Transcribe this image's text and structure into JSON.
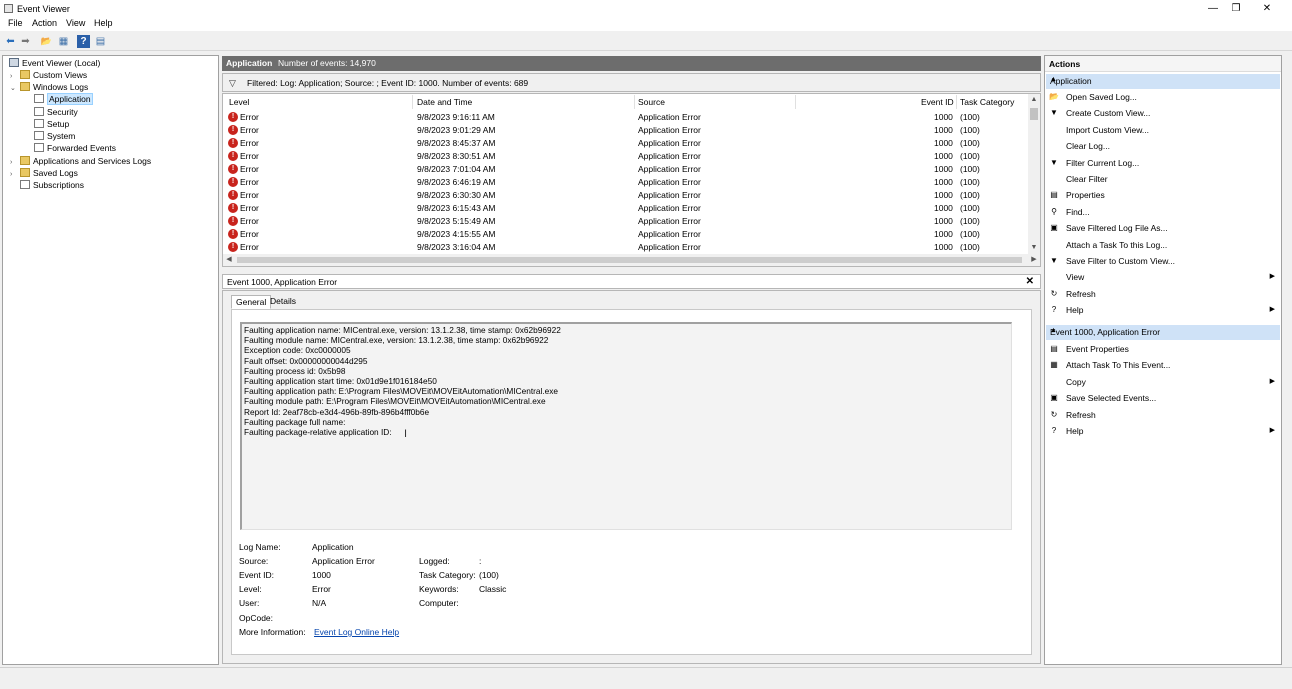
{
  "window": {
    "title": "Event Viewer",
    "minimize": "—",
    "restore": "❐",
    "close": "✕"
  },
  "menu": [
    "File",
    "Action",
    "View",
    "Help"
  ],
  "toolbar": {
    "back": "⬅",
    "forward": "➡",
    "up": "📂",
    "show_hide": "▦",
    "help": "?",
    "console": "▤"
  },
  "tree": {
    "items": [
      {
        "label": "Event Viewer (Local)",
        "expander": ""
      },
      {
        "label": "Custom Views",
        "expander": "›"
      },
      {
        "label": "Windows Logs",
        "expander": "⌄"
      },
      {
        "label": "Application",
        "expander": ""
      },
      {
        "label": "Security",
        "expander": ""
      },
      {
        "label": "Setup",
        "expander": ""
      },
      {
        "label": "System",
        "expander": ""
      },
      {
        "label": "Forwarded Events",
        "expander": ""
      },
      {
        "label": "Applications and Services Logs",
        "expander": "›"
      },
      {
        "label": "Saved Logs",
        "expander": "›"
      },
      {
        "label": "Subscriptions",
        "expander": ""
      }
    ]
  },
  "center": {
    "header_log": "Application",
    "header_count": "Number of events: 14,970",
    "filter_text": "Filtered: Log: Application; Source: ; Event ID: 1000. Number of events: 689"
  },
  "grid": {
    "columns": [
      "Level",
      "Date and Time",
      "Source",
      "Event ID",
      "Task Category"
    ],
    "rows": [
      {
        "level": "Error",
        "date": "9/8/2023 9:16:11 AM",
        "source": "Application Error",
        "event_id": "1000",
        "task": "(100)"
      },
      {
        "level": "Error",
        "date": "9/8/2023 9:01:29 AM",
        "source": "Application Error",
        "event_id": "1000",
        "task": "(100)"
      },
      {
        "level": "Error",
        "date": "9/8/2023 8:45:37 AM",
        "source": "Application Error",
        "event_id": "1000",
        "task": "(100)"
      },
      {
        "level": "Error",
        "date": "9/8/2023 8:30:51 AM",
        "source": "Application Error",
        "event_id": "1000",
        "task": "(100)"
      },
      {
        "level": "Error",
        "date": "9/8/2023 7:01:04 AM",
        "source": "Application Error",
        "event_id": "1000",
        "task": "(100)"
      },
      {
        "level": "Error",
        "date": "9/8/2023 6:46:19 AM",
        "source": "Application Error",
        "event_id": "1000",
        "task": "(100)"
      },
      {
        "level": "Error",
        "date": "9/8/2023 6:30:30 AM",
        "source": "Application Error",
        "event_id": "1000",
        "task": "(100)"
      },
      {
        "level": "Error",
        "date": "9/8/2023 6:15:43 AM",
        "source": "Application Error",
        "event_id": "1000",
        "task": "(100)"
      },
      {
        "level": "Error",
        "date": "9/8/2023 5:15:49 AM",
        "source": "Application Error",
        "event_id": "1000",
        "task": "(100)"
      },
      {
        "level": "Error",
        "date": "9/8/2023 4:15:55 AM",
        "source": "Application Error",
        "event_id": "1000",
        "task": "(100)"
      },
      {
        "level": "Error",
        "date": "9/8/2023 3:16:04 AM",
        "source": "Application Error",
        "event_id": "1000",
        "task": "(100)"
      }
    ]
  },
  "detail": {
    "header": "Event 1000, Application Error",
    "close": "✕",
    "tabs": [
      "General",
      "Details"
    ],
    "description_lines": [
      "Faulting application name: MICentral.exe, version: 13.1.2.38, time stamp: 0x62b96922",
      "Faulting module name: MICentral.exe, version: 13.1.2.38, time stamp: 0x62b96922",
      "Exception code: 0xc0000005",
      "Fault offset: 0x00000000044d295",
      "Faulting process id: 0x5b98",
      "Faulting application start time: 0x01d9e1f016184e50",
      "Faulting application path: E:\\Program Files\\MOVEit\\MOVEitAutomation\\MICentral.exe",
      "Faulting module path: E:\\Program Files\\MOVEit\\MOVEitAutomation\\MICentral.exe",
      "Report Id: 2eaf78cb-e3d4-496b-89fb-896b4fff0b6e",
      "Faulting package full name:",
      "Faulting package-relative application ID:"
    ],
    "props": {
      "log_name_label": "Log Name:",
      "log_name": "Application",
      "source_label": "Source:",
      "source": "Application Error",
      "logged_label": "Logged:",
      "logged": ":",
      "event_id_label": "Event ID:",
      "event_id": "1000",
      "task_label": "Task Category:",
      "task": "(100)",
      "level_label": "Level:",
      "level": "Error",
      "keywords_label": "Keywords:",
      "keywords": "Classic",
      "user_label": "User:",
      "user": "N/A",
      "computer_label": "Computer:",
      "opcode_label": "OpCode:",
      "more_info_label": "More Information:",
      "more_info_link": "Event Log Online Help"
    }
  },
  "actions": {
    "title": "Actions",
    "section1": "Application",
    "items1": [
      {
        "label": "Open Saved Log...",
        "icon": "📂",
        "arrow": ""
      },
      {
        "label": "Create Custom View...",
        "icon": "▼",
        "arrow": ""
      },
      {
        "label": "Import Custom View...",
        "icon": "",
        "arrow": ""
      },
      {
        "label": "Clear Log...",
        "icon": "",
        "arrow": ""
      },
      {
        "label": "Filter Current Log...",
        "icon": "▼",
        "arrow": ""
      },
      {
        "label": "Clear Filter",
        "icon": "",
        "arrow": ""
      },
      {
        "label": "Properties",
        "icon": "▤",
        "arrow": ""
      },
      {
        "label": "Find...",
        "icon": "⚲",
        "arrow": ""
      },
      {
        "label": "Save Filtered Log File As...",
        "icon": "▣",
        "arrow": ""
      },
      {
        "label": "Attach a Task To this Log...",
        "icon": "",
        "arrow": ""
      },
      {
        "label": "Save Filter to Custom View...",
        "icon": "▼",
        "arrow": ""
      },
      {
        "label": "View",
        "icon": "",
        "arrow": "▶"
      },
      {
        "label": "Refresh",
        "icon": "↻",
        "arrow": ""
      },
      {
        "label": "Help",
        "icon": "?",
        "arrow": "▶"
      }
    ],
    "section2": "Event 1000, Application Error",
    "items2": [
      {
        "label": "Event Properties",
        "icon": "▤",
        "arrow": ""
      },
      {
        "label": "Attach Task To This Event...",
        "icon": "▦",
        "arrow": ""
      },
      {
        "label": "Copy",
        "icon": "",
        "arrow": "▶"
      },
      {
        "label": "Save Selected Events...",
        "icon": "▣",
        "arrow": ""
      },
      {
        "label": "Refresh",
        "icon": "↻",
        "arrow": ""
      },
      {
        "label": "Help",
        "icon": "?",
        "arrow": "▶"
      }
    ],
    "collapse": "▲"
  },
  "colors": {
    "accent_section": "#cfe2f7",
    "error_red": "#c8231c",
    "link": "#0645ad",
    "header_gray": "#6d6d6d"
  }
}
